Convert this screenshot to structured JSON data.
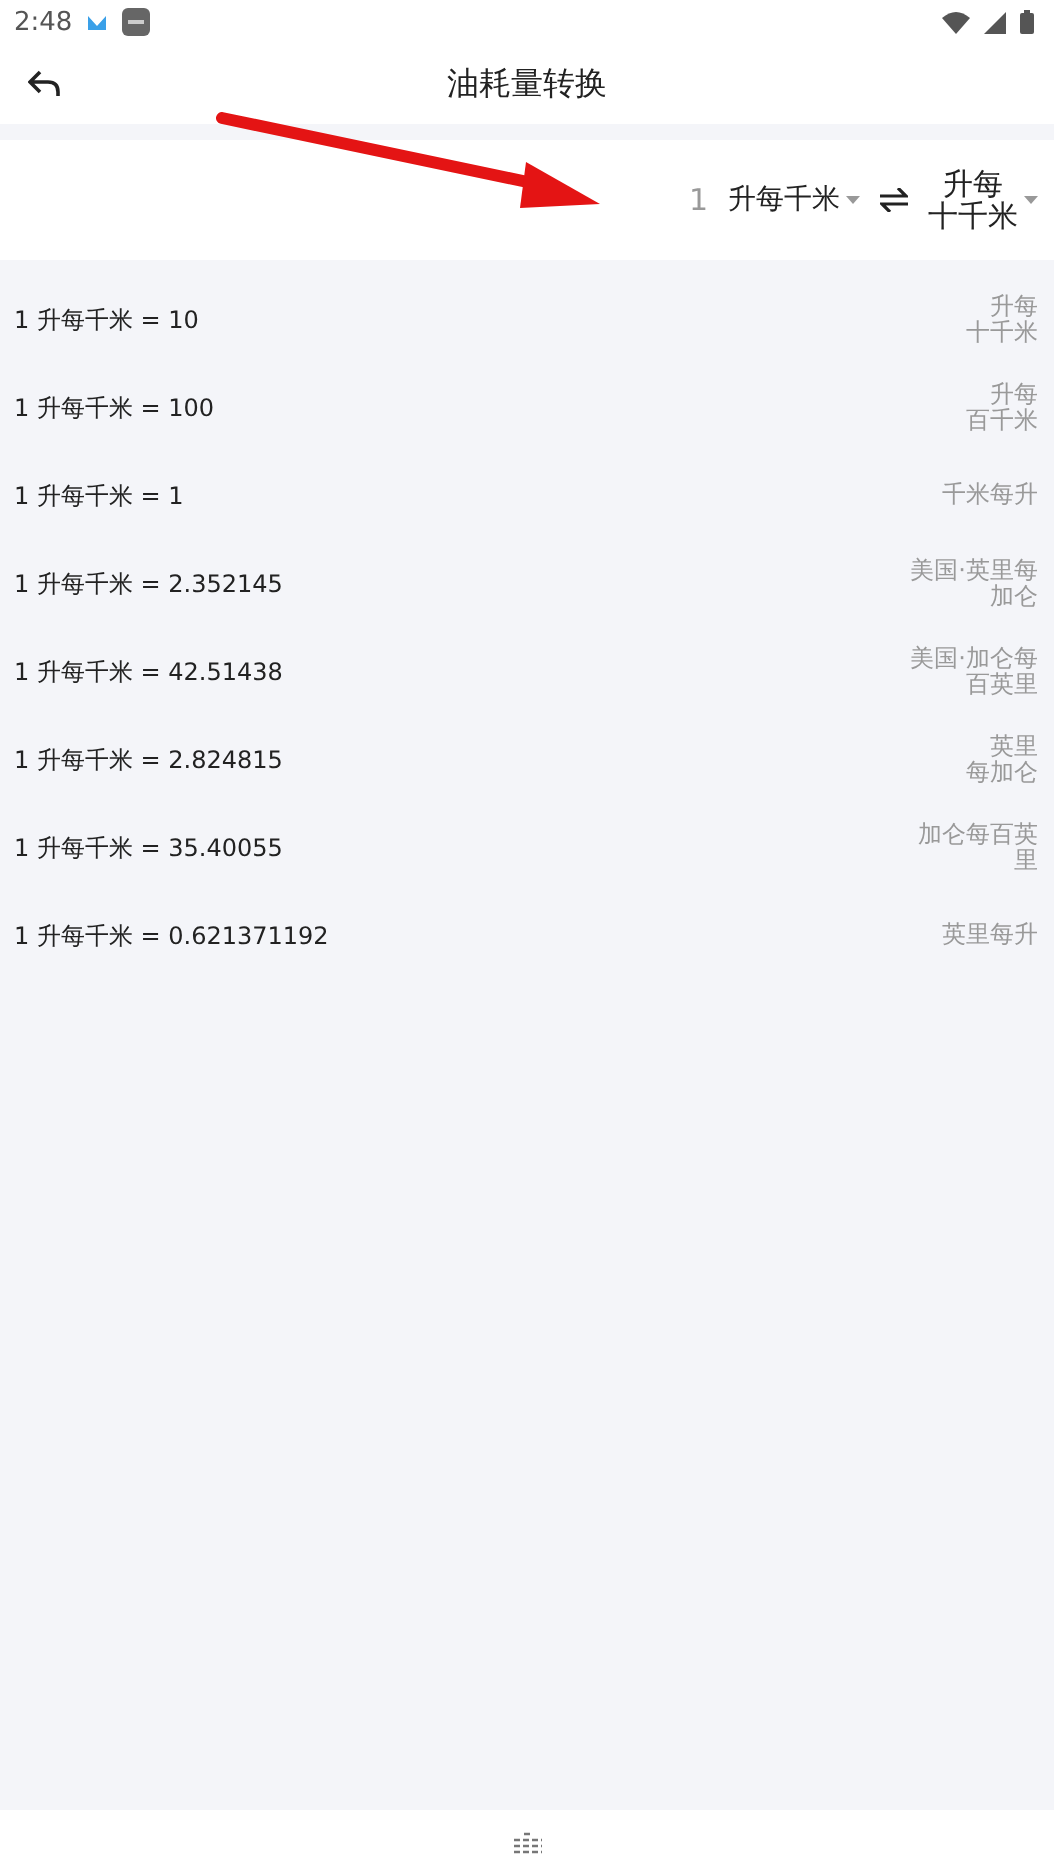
{
  "status_bar": {
    "time": "2:48"
  },
  "header": {
    "title": "油耗量转换"
  },
  "converter": {
    "amount": "1",
    "from_unit": "升每千米",
    "to_unit_lines": [
      "升每",
      "十千米"
    ]
  },
  "results": [
    {
      "text": "1 升每千米 = 10",
      "unit_lines": [
        "升每",
        "十千米"
      ]
    },
    {
      "text": "1 升每千米 = 100",
      "unit_lines": [
        "升每",
        "百千米"
      ]
    },
    {
      "text": "1 升每千米 = 1",
      "unit_lines": [
        "千米每升"
      ]
    },
    {
      "text": "1 升每千米 = 2.352145",
      "unit_lines": [
        "美国·英里每",
        "加仑"
      ]
    },
    {
      "text": "1 升每千米 = 42.51438",
      "unit_lines": [
        "美国·加仑每",
        "百英里"
      ]
    },
    {
      "text": "1 升每千米 = 2.824815",
      "unit_lines": [
        "英里",
        "每加仑"
      ]
    },
    {
      "text": "1 升每千米 = 35.40055",
      "unit_lines": [
        "加仑每百英",
        "里"
      ]
    },
    {
      "text": "1 升每千米 = 0.621371192",
      "unit_lines": [
        "英里每升"
      ]
    }
  ]
}
